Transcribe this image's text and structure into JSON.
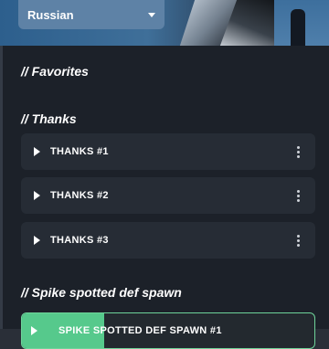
{
  "language_select": {
    "value": "Russian"
  },
  "sections": {
    "favorites": {
      "title": "// Favorites"
    },
    "thanks": {
      "title": "// Thanks",
      "items": [
        {
          "label": "THANKS #1"
        },
        {
          "label": "THANKS #2"
        },
        {
          "label": "THANKS #3"
        }
      ]
    },
    "spike": {
      "title": "// Spike spotted def spawn",
      "items": [
        {
          "label": "SPIKE SPOTTED DEF SPAWN #1",
          "progress": 0.28
        }
      ]
    }
  },
  "icons": {
    "caret": "chevron-down-icon",
    "play": "play-icon",
    "menu": "kebab-menu-icon"
  },
  "colors": {
    "accent": "#56c98c",
    "panel": "#1c2129",
    "item": "#262c35"
  }
}
